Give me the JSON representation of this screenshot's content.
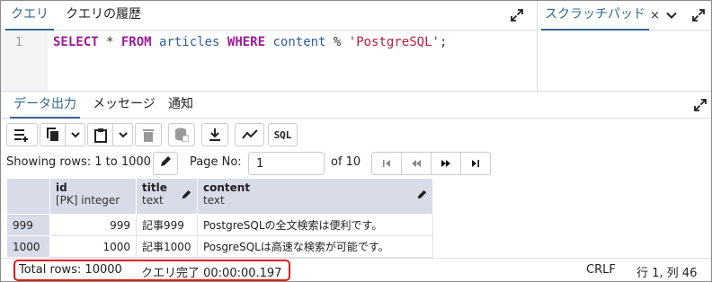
{
  "query_tabs": {
    "query": "クエリ",
    "history": "クエリの履歴"
  },
  "scratch": {
    "tab": "スクラッチパッド",
    "close": "×"
  },
  "editor": {
    "line_number": "1",
    "tokens": {
      "select": "SELECT",
      "star": " * ",
      "from": "FROM",
      "table": " articles ",
      "where": "WHERE",
      "col": " content ",
      "op": "%",
      "sp": " ",
      "str": "'PostgreSQL'",
      "semi": ";"
    }
  },
  "result_tabs": {
    "data_output": "データ出力",
    "messages": "メッセージ",
    "notifications": "通知"
  },
  "toolbar": {
    "sql_label": "SQL"
  },
  "pager": {
    "showing": "Showing rows: 1 to 1000",
    "page_no_label": "Page No:",
    "page_value": "1",
    "of_label": "of 10"
  },
  "grid": {
    "columns": [
      {
        "name": "id",
        "type": "[PK] integer"
      },
      {
        "name": "title",
        "type": "text"
      },
      {
        "name": "content",
        "type": "text"
      }
    ],
    "rows": [
      {
        "rownum": "999",
        "id": "999",
        "title": "記事999",
        "content": "PostgreSQLの全文検索は便利です。"
      },
      {
        "rownum": "1000",
        "id": "1000",
        "title": "記事1000",
        "content": "PosgreSQLは高速な検索が可能です。"
      }
    ]
  },
  "status": {
    "total_rows": "Total rows: 10000",
    "query_done": "クエリ完了 00:00:00.197",
    "line_ending": "CRLF",
    "cursor": "行 1, 列 46"
  },
  "colors": {
    "accent": "#326690",
    "header_bg": "#d8dbe8",
    "highlight_border": "#e01919"
  }
}
